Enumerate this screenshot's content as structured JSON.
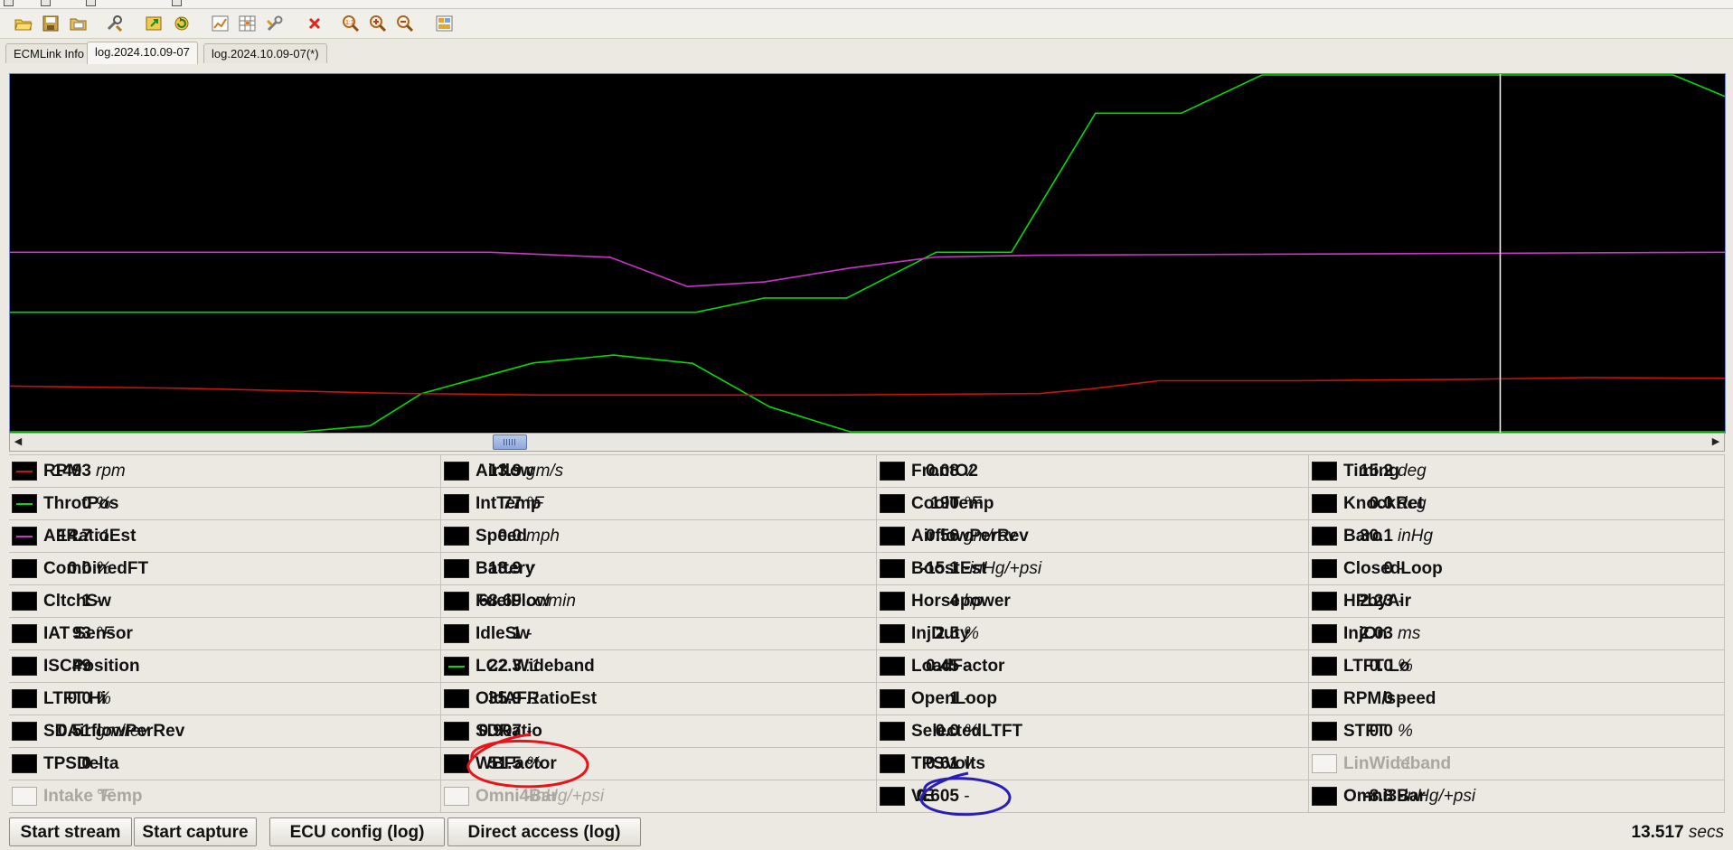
{
  "toolbar": {
    "icons": [
      "open-folder-icon",
      "save-icon",
      "open-log-icon",
      "tools-icon",
      "export-icon",
      "refresh-icon",
      "chart-settings-icon",
      "grid-settings-icon",
      "wrench-icon",
      "delete-icon",
      "zoom-reset-icon",
      "zoom-in-icon",
      "zoom-out-icon",
      "layout-icon"
    ]
  },
  "tabs": [
    {
      "label": "ECMLink Info",
      "active": false
    },
    {
      "label": "log.2024.10.09-07",
      "active": true
    },
    {
      "label": "log.2024.10.09-07(*)",
      "active": false
    }
  ],
  "graph": {
    "background": "#000000",
    "cursor_color": "#ffffff",
    "series": [
      {
        "param": "ThrotPos",
        "color": "#00dd00",
        "note": "throttle trace (upper)",
        "points": [
          [
            0,
            0.665
          ],
          [
            0.4,
            0.665
          ],
          [
            0.44,
            0.625
          ],
          [
            0.488,
            0.625
          ],
          [
            0.54,
            0.497
          ],
          [
            0.584,
            0.497
          ],
          [
            0.633,
            0.107
          ],
          [
            0.683,
            0.107
          ],
          [
            0.73,
            0.0
          ],
          [
            0.97,
            0.0
          ],
          [
            1.0,
            0.06
          ]
        ]
      },
      {
        "param": "AFRatioEst",
        "color": "#cc33cc",
        "points": [
          [
            0,
            0.497
          ],
          [
            0.28,
            0.497
          ],
          [
            0.35,
            0.511
          ],
          [
            0.395,
            0.593
          ],
          [
            0.44,
            0.58
          ],
          [
            0.49,
            0.541
          ],
          [
            0.54,
            0.51
          ],
          [
            0.6,
            0.505
          ],
          [
            1.0,
            0.497
          ]
        ]
      },
      {
        "param": "LC2 Wideband",
        "color": "#00dd00",
        "points": [
          [
            0,
            1.0
          ],
          [
            0.17,
            1.0
          ],
          [
            0.21,
            0.983
          ],
          [
            0.24,
            0.893
          ],
          [
            0.305,
            0.807
          ],
          [
            0.352,
            0.785
          ],
          [
            0.398,
            0.808
          ],
          [
            0.443,
            0.93
          ],
          [
            0.49,
            1.0
          ],
          [
            1.0,
            1.0
          ]
        ]
      },
      {
        "param": "RPM",
        "color": "#cc1111",
        "points": [
          [
            0,
            0.872
          ],
          [
            0.1,
            0.878
          ],
          [
            0.22,
            0.892
          ],
          [
            0.31,
            0.897
          ],
          [
            0.48,
            0.897
          ],
          [
            0.6,
            0.893
          ],
          [
            0.63,
            0.88
          ],
          [
            0.67,
            0.857
          ],
          [
            0.75,
            0.857
          ],
          [
            0.85,
            0.853
          ],
          [
            0.92,
            0.848
          ],
          [
            1.0,
            0.85
          ]
        ]
      }
    ],
    "cursor_position": 0.869
  },
  "params": [
    [
      {
        "name": "RPM",
        "value": "1493",
        "unit": "rpm",
        "line_color": "#cc1111",
        "enabled": true
      },
      {
        "name": "ThrotPos",
        "value": "0",
        "unit": "%",
        "line_color": "#00dd00",
        "enabled": true
      },
      {
        "name": "AFRatioEst",
        "value": "14.7",
        "unit": ":1",
        "line_color": "#cc33cc",
        "enabled": true
      },
      {
        "name": "CombinedFT",
        "value": "0.0",
        "unit": "%",
        "enabled": true
      },
      {
        "name": "CltchSw",
        "value": "1",
        "unit": "-",
        "enabled": true
      },
      {
        "name": "IAT Sensor",
        "value": "93",
        "unit": "°F",
        "enabled": true
      },
      {
        "name": "ISCPosition",
        "value": "49",
        "unit": "-",
        "enabled": true
      },
      {
        "name": "LTFT Hi",
        "value": "0.0",
        "unit": "%",
        "enabled": true
      },
      {
        "name": "SDAirflowPerRev",
        "value": "0.51",
        "unit": "gm/rev",
        "enabled": true
      },
      {
        "name": "TPSDelta",
        "value": "0",
        "unit": "-",
        "enabled": true
      },
      {
        "name": "Intake Temp",
        "value": "",
        "unit": "°F",
        "enabled": false
      }
    ],
    [
      {
        "name": "Airflow",
        "value": "13.9",
        "unit": "gm/s",
        "enabled": true
      },
      {
        "name": "IntTemp",
        "value": "77",
        "unit": "°F",
        "enabled": true
      },
      {
        "name": "Speed",
        "value": "0.0",
        "unit": "mph",
        "enabled": true
      },
      {
        "name": "Battery",
        "value": "13.9",
        "unit": "v",
        "enabled": true
      },
      {
        "name": "FuelFlow",
        "value": "68.69",
        "unit": "cc/min",
        "enabled": true
      },
      {
        "name": "IdleSw",
        "value": "1",
        "unit": "-",
        "enabled": true
      },
      {
        "name": "LC2 Wideband",
        "value": "22.3",
        "unit": ":1",
        "line_color": "#00dd00",
        "enabled": true
      },
      {
        "name": "OldAFRatioEst",
        "value": "35.9",
        "unit": ":1",
        "enabled": true
      },
      {
        "name": "SDRatio",
        "value": "0.907",
        "unit": "-",
        "enabled": true
      },
      {
        "name": "WBFactor",
        "value": "51.5",
        "unit": "%",
        "enabled": true
      },
      {
        "name": "Omni4Bar",
        "value": "",
        "unit": "-inHg/+psi",
        "enabled": false
      }
    ],
    [
      {
        "name": "FrontO2",
        "value": "0.08",
        "unit": "v",
        "enabled": true
      },
      {
        "name": "CoolTemp",
        "value": "190",
        "unit": "°F",
        "enabled": true
      },
      {
        "name": "AirflowPerRev",
        "value": "0.56",
        "unit": "gm/rev",
        "enabled": true
      },
      {
        "name": "BoostEst",
        "value": "-15.1",
        "unit": "-inHg/+psi",
        "enabled": true
      },
      {
        "name": "Horsepower",
        "value": "4",
        "unit": "hp",
        "enabled": true
      },
      {
        "name": "InjDuty",
        "value": "2.5",
        "unit": "%",
        "enabled": true
      },
      {
        "name": "LoadFactor",
        "value": "0.45",
        "unit": "-",
        "enabled": true
      },
      {
        "name": "OpenLoop",
        "value": "1",
        "unit": "-",
        "enabled": true
      },
      {
        "name": "SelectedLTFT",
        "value": "0.0",
        "unit": "%",
        "enabled": true
      },
      {
        "name": "TPSVolts",
        "value": "0.61",
        "unit": "v",
        "enabled": true
      },
      {
        "name": "VE",
        "value": "0.605",
        "unit": "-",
        "enabled": true
      }
    ],
    [
      {
        "name": "Timing",
        "value": "15.2",
        "unit": "deg",
        "enabled": true
      },
      {
        "name": "KnockRet",
        "value": "0.0",
        "unit": "deg",
        "enabled": true
      },
      {
        "name": "Baro",
        "value": "30.1",
        "unit": "inHg",
        "enabled": true
      },
      {
        "name": "ClosedLoop",
        "value": "0",
        "unit": "-",
        "enabled": true
      },
      {
        "name": "HPbyAir",
        "value": "2.23",
        "unit": "-",
        "enabled": true
      },
      {
        "name": "InjOn",
        "value": "2.03",
        "unit": "ms",
        "enabled": true
      },
      {
        "name": "LTFT Lo",
        "value": "0.0",
        "unit": "%",
        "enabled": true
      },
      {
        "name": "RPM/speed",
        "value": "0",
        "unit": "-",
        "enabled": true
      },
      {
        "name": "STFT",
        "value": "0.0",
        "unit": "%",
        "enabled": true
      },
      {
        "name": "LinWideband",
        "value": "",
        "unit": ":1",
        "enabled": false
      },
      {
        "name": "Omni3Bar",
        "value": "-8.8",
        "unit": "-inHg/+psi",
        "enabled": true
      }
    ]
  ],
  "annotations": [
    {
      "target": "WBFactor",
      "shape": "ellipse",
      "color": "#e8141c"
    },
    {
      "target": "VE",
      "shape": "ellipse",
      "color": "#2a1fb5"
    }
  ],
  "buttons": {
    "start_stream": "Start stream",
    "start_capture": "Start capture",
    "ecu_config": "ECU config (log)",
    "direct_access": "Direct access (log)"
  },
  "time": {
    "value": "13.517",
    "unit": "secs"
  }
}
